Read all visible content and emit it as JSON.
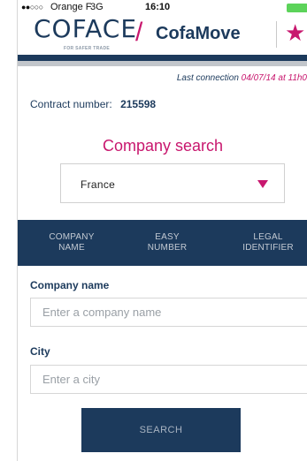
{
  "status_bar": {
    "signal": "●●○○○",
    "carrier": "Orange F",
    "network": "3G",
    "time": "16:10"
  },
  "header": {
    "logo_text": "COFACE",
    "logo_tagline": "FOR SAFER TRADE",
    "slash": "/",
    "app_name": "CofaMove",
    "star_icon": "★",
    "colors": {
      "navy": "#1c3a5c",
      "magenta": "#c8176e"
    }
  },
  "last_connection": {
    "label": "Last connection",
    "value": "04/07/14 at 11h0"
  },
  "contract": {
    "label": "Contract number:",
    "value": "215598"
  },
  "search": {
    "title": "Company search",
    "country_selected": "France",
    "tabs": [
      {
        "line1": "COMPANY",
        "line2": "NAME"
      },
      {
        "line1": "EASY",
        "line2": "NUMBER"
      },
      {
        "line1": "LEGAL",
        "line2": "IDENTIFIER"
      }
    ],
    "company_label": "Company name",
    "company_placeholder": "Enter a company name",
    "city_label": "City",
    "city_placeholder": "Enter a city",
    "button_label": "SEARCH"
  }
}
